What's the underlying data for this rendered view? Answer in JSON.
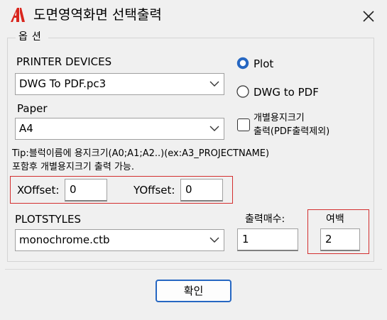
{
  "window": {
    "title": "도면영역화면 선택출력",
    "logo_icon": "autocad-a-icon",
    "close_icon": "close-icon"
  },
  "options_group": {
    "legend": "옵션"
  },
  "printer": {
    "label": "PRINTER DEVICES",
    "selected": "DWG To PDF.pc3"
  },
  "output_mode": {
    "options": [
      {
        "label": "Plot",
        "selected": true
      },
      {
        "label": "DWG to PDF",
        "selected": false
      }
    ]
  },
  "paper": {
    "label": "Paper",
    "selected": "A4"
  },
  "individual_paper": {
    "line1": "개별용지크기",
    "line2": "출력(PDF출력제외)",
    "checked": false
  },
  "tip": {
    "line1": "Tip:블럭이름에 용지크기(A0;A1;A2..)(ex:A3_PROJECTNAME)",
    "line2": "포함후 개별용지크기 출력 가능."
  },
  "offset": {
    "x_label": "XOffset:",
    "x_value": "0",
    "y_label": "YOffset:",
    "y_value": "0"
  },
  "plotstyles": {
    "label": "PLOTSTYLES",
    "selected": "monochrome.ctb"
  },
  "copies": {
    "label": "출력매수:",
    "value": "1"
  },
  "margin": {
    "label": "여백",
    "value": "2"
  },
  "footer": {
    "ok_label": "확인"
  },
  "colors": {
    "accent": "#2667c2",
    "highlight_box": "#d32f2f",
    "logo_red": "#d9251d"
  }
}
